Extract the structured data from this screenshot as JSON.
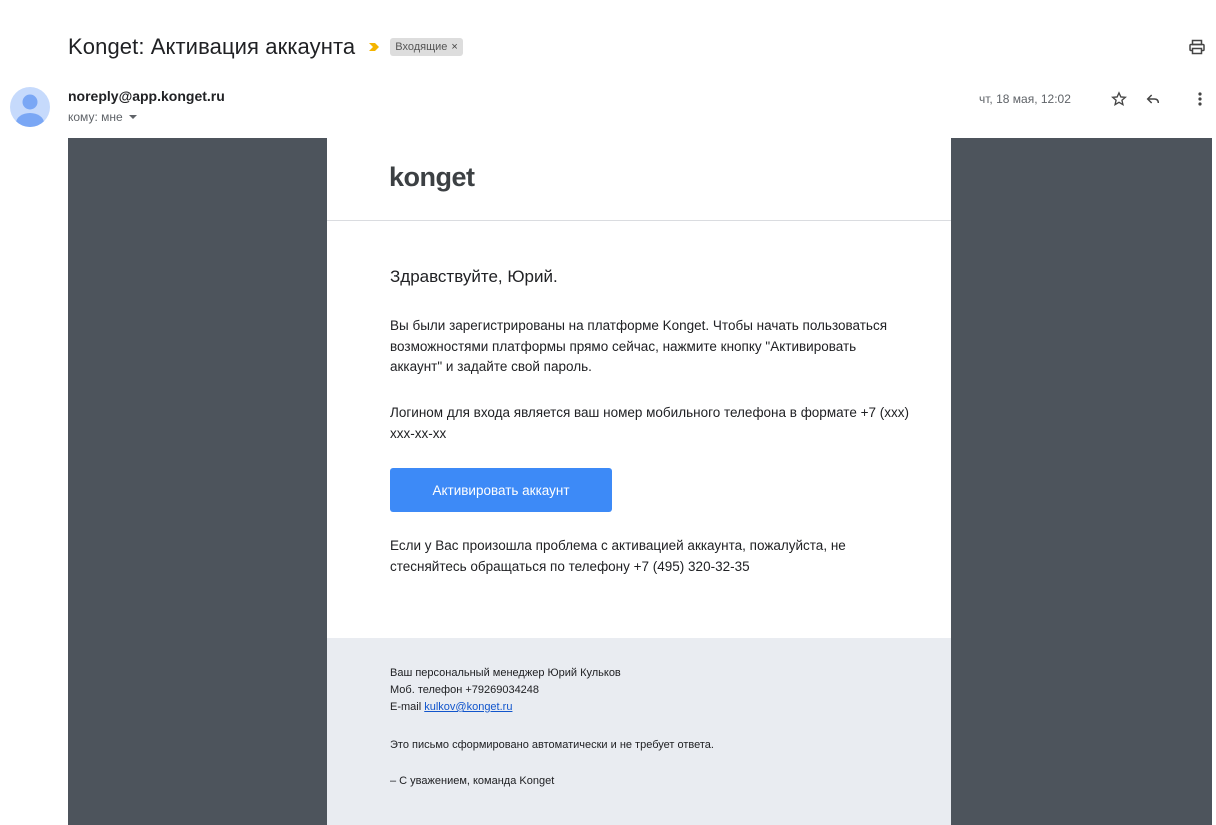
{
  "subject": "Konget: Активация аккаунта",
  "label_chip": {
    "text": "Входящие",
    "close": "×"
  },
  "sender": {
    "email": "noreply@app.konget.ru",
    "to": "кому: мне"
  },
  "date": "чт, 18 мая, 12:02",
  "icons": {
    "importance": "importance-marker-icon",
    "print": "print-icon",
    "avatar": "default-avatar-icon",
    "star": "star-icon",
    "reply": "reply-icon",
    "more": "more-vertical-icon"
  },
  "colors": {
    "accent_button": "#3d8af7",
    "background_dark": "#4d545c",
    "footer_bg": "#e9ecf1",
    "importance": "#f4b400"
  },
  "body": {
    "logo": "konget",
    "greeting": "Здравствуйте, Юрий.",
    "p1": "Вы были зарегистрированы на платформе Konget. Чтобы начать пользоваться возможностями платформы прямо сейчас, нажмите кнопку \"Активировать аккаунт\" и задайте свой пароль.",
    "p2": "Логином для входа является ваш номер мобильного телефона в формате +7 (xxx) xxx-xx-xx",
    "button": "Активировать аккаунт",
    "p3": "Если у Вас произошла проблема с активацией аккаунта, пожалуйста, не стесняйтесь обращаться по телефону +7 (495) 320-32-35"
  },
  "footer": {
    "manager": "Ваш персональный менеджер Юрий Кульков",
    "phone": "Моб. телефон +79269034248",
    "email_label": "E-mail",
    "email": "kulkov@konget.ru",
    "auto_note": "Это письмо сформировано автоматически и не требует ответа.",
    "sign": "– С уважением, команда Konget"
  }
}
